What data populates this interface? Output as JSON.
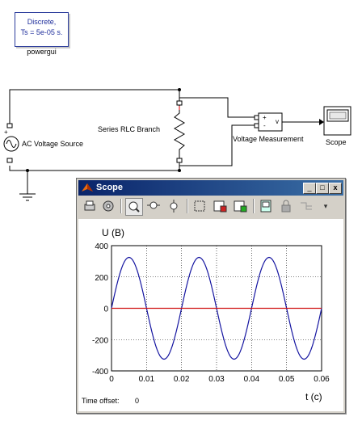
{
  "powergui": {
    "line1": "Discrete,",
    "line2": "Ts = 5e-05 s.",
    "label": "powergui"
  },
  "blocks": {
    "ac_source_label": "AC Voltage Source",
    "rlc_label": "Series RLC Branch",
    "vm_label": "Voltage Measurement",
    "vm_port_plus": "+",
    "vm_port_minus": "-",
    "vm_out": "v",
    "scope_label": "Scope"
  },
  "scope_window": {
    "title": "Scope",
    "minimize": "_",
    "maximize": "□",
    "close": "x",
    "toolbar": [
      "print-icon",
      "parameters-icon",
      "zoom-icon",
      "zoom-x-icon",
      "zoom-y-icon",
      "autoscale-icon",
      "save-axes-icon",
      "restore-axes-icon",
      "floating-scope-icon",
      "lock-icon",
      "signal-selection-icon",
      "dropdown-icon"
    ],
    "time_offset_label": "Time offset:",
    "time_offset_value": "0"
  },
  "chart_data": {
    "type": "line",
    "ylabel": "U (B)",
    "xlabel": "t (c)",
    "xlim": [
      0,
      0.06
    ],
    "ylim": [
      -400,
      400
    ],
    "xticks": [
      "0",
      "0.01",
      "0.02",
      "0.03",
      "0.04",
      "0.05",
      "0.06"
    ],
    "yticks": [
      "400",
      "200",
      "0",
      "-200",
      "-400"
    ],
    "grid": true,
    "series": [
      {
        "amplitude": 325,
        "frequency": 50,
        "color": "#1414a0",
        "x": [
          0,
          0.0025,
          0.005,
          0.0075,
          0.01,
          0.0125,
          0.015,
          0.0175,
          0.02,
          0.0225,
          0.025,
          0.0275,
          0.03,
          0.0325,
          0.035,
          0.0375,
          0.04,
          0.0425,
          0.045,
          0.0475,
          0.05,
          0.0525,
          0.055,
          0.0575,
          0.06
        ],
        "y": [
          0,
          230,
          325,
          230,
          0,
          -230,
          -325,
          -230,
          0,
          230,
          325,
          230,
          0,
          -230,
          -325,
          -230,
          0,
          230,
          325,
          230,
          0,
          -230,
          -325,
          -230,
          0
        ]
      },
      {
        "color": "#d01010",
        "x": [
          0,
          0.06
        ],
        "y": [
          0,
          0
        ]
      }
    ]
  }
}
